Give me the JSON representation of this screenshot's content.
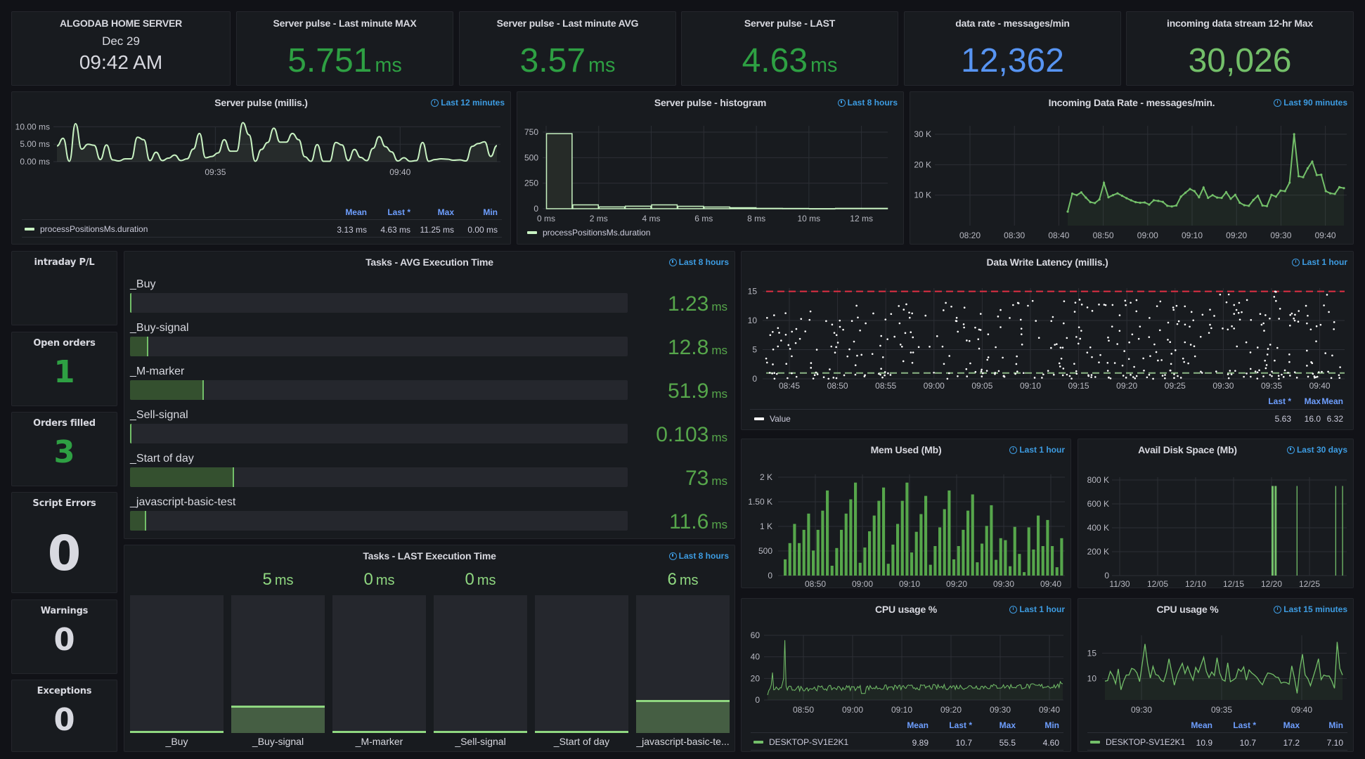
{
  "colors": {
    "green": "#2ea043",
    "green_light": "#73bf69",
    "line_pale": "#c8f2c2",
    "blue": "#5794f2",
    "threshold_red": "#e02f44",
    "threshold_green": "#8ab383"
  },
  "header_panel": {
    "title": "ALGODAB HOME SERVER",
    "date": "Dec 29",
    "time": "09:42 AM"
  },
  "stats": [
    {
      "title": "Server pulse - Last minute MAX",
      "value": "5.751",
      "unit": "ms",
      "color": "#2ea043"
    },
    {
      "title": "Server pulse - Last minute AVG",
      "value": "3.57",
      "unit": "ms",
      "color": "#2ea043"
    },
    {
      "title": "Server pulse - LAST",
      "value": "4.63",
      "unit": "ms",
      "color": "#2ea043"
    },
    {
      "title": "data rate - messages/min",
      "value": "12,362",
      "unit": "",
      "color": "#5794f2"
    },
    {
      "title": "incoming data stream 12-hr Max",
      "value": "30,026",
      "unit": "",
      "color": "#73bf69"
    }
  ],
  "side_stats": [
    {
      "title": "intraday P/L",
      "value": "",
      "color": "#2ea043"
    },
    {
      "title": "Open orders",
      "value": "1",
      "color": "#2ea043"
    },
    {
      "title": "Orders filled",
      "value": "3",
      "color": "#2ea043"
    },
    {
      "title": "Script Errors",
      "value": "0",
      "color": "#d8d9e0"
    },
    {
      "title": "Warnings",
      "value": "0",
      "color": "#d8d9e0"
    },
    {
      "title": "Exceptions",
      "value": "0",
      "color": "#d8d9e0"
    }
  ],
  "chart_data": [
    {
      "id": "server_pulse",
      "type": "line",
      "title": "Server pulse (millis.)",
      "time_range": "Last 12 minutes",
      "yticks": [
        "0.00 ms",
        "5.00 ms",
        "10.00 ms"
      ],
      "ylim": [
        0,
        11.5
      ],
      "xticks": [
        {
          "label": "09:35",
          "pos": 0.36
        },
        {
          "label": "09:40",
          "pos": 0.78
        }
      ],
      "series": [
        {
          "name": "processPositionsMs.duration",
          "values": [
            4.5,
            6.7,
            0.1,
            10.9,
            3.6,
            5.0,
            4.7,
            0.6,
            4.8,
            0.5,
            0.2,
            0.8,
            0.8,
            7.0,
            6.3,
            0.3,
            2.7,
            0.3,
            1.0,
            1.9,
            0.3,
            0.8,
            3.6,
            8.1,
            1.1,
            1.5,
            2.5,
            6.3,
            3.0,
            3.0,
            11.2,
            7.7,
            0.1,
            3.5,
            5.5,
            9.6,
            5.6,
            5.6,
            8.1,
            6.3,
            1.4,
            0.1,
            4.9,
            0.1,
            0.1,
            5.5,
            4.8,
            0.3,
            3.5,
            1.2,
            0.3,
            3.8,
            7.2,
            4.3,
            2.8,
            0.2,
            1.1,
            0.1,
            0.3,
            5.5,
            0.1,
            0.6,
            0.8,
            0.7,
            0.4,
            0.5,
            0.2,
            4.4,
            5.2,
            5.7,
            1.5,
            4.6
          ]
        }
      ],
      "legend_headers": [
        "Mean",
        "Last *",
        "Max",
        "Min"
      ],
      "legend_values": [
        "3.13 ms",
        "4.63 ms",
        "11.25 ms",
        "0.00 ms"
      ]
    },
    {
      "id": "histogram",
      "type": "bar",
      "title": "Server pulse - histogram",
      "time_range": "Last 8 hours",
      "yticks": [
        "0",
        "250",
        "500",
        "750"
      ],
      "ylim": [
        0,
        800
      ],
      "xticks": [
        "0 ms",
        "2 ms",
        "4 ms",
        "6 ms",
        "8 ms",
        "10 ms",
        "12 ms"
      ],
      "xlim": [
        0,
        13
      ],
      "bins": [
        735,
        38,
        18,
        25,
        38,
        24,
        17,
        10,
        4,
        3,
        1,
        4,
        4
      ],
      "series_name": "processPositionsMs.duration"
    },
    {
      "id": "data_rate",
      "type": "line",
      "title": "Incoming Data Rate - messages/min.",
      "time_range": "Last 90 minutes",
      "yticks": [
        "10 K",
        "20 K",
        "30 K"
      ],
      "ylim": [
        0,
        33000
      ],
      "xticks": [
        "08:20",
        "08:30",
        "08:40",
        "08:50",
        "09:00",
        "09:10",
        "09:20",
        "09:30",
        "09:40"
      ],
      "x_start_min": 8.0,
      "x_end_min": 100,
      "start_offset_min": 32,
      "values": [
        4600,
        10500,
        10000,
        10900,
        9200,
        7700,
        7400,
        8600,
        14000,
        9300,
        10000,
        10600,
        9800,
        9000,
        8300,
        7700,
        7500,
        7600,
        6900,
        8300,
        8100,
        7800,
        6500,
        6300,
        6600,
        9500,
        10800,
        12000,
        11300,
        9300,
        12500,
        9100,
        10000,
        9200,
        9100,
        11000,
        8800,
        10100,
        7500,
        6700,
        6500,
        8400,
        9800,
        6600,
        6400,
        10100,
        9500,
        11500,
        11300,
        14100,
        30000,
        16200,
        15900,
        18800,
        21000,
        16600,
        16700,
        11300,
        10600,
        10400,
        12600,
        12300
      ]
    },
    {
      "id": "write_latency",
      "type": "scatter",
      "title": "Data Write Latency (millis.)",
      "time_range": "Last 1 hour",
      "yticks": [
        "0",
        "5",
        "10",
        "15"
      ],
      "ylim": [
        0,
        17
      ],
      "xticks": [
        "08:45",
        "08:50",
        "08:55",
        "09:00",
        "09:05",
        "09:10",
        "09:15",
        "09:20",
        "09:25",
        "09:30",
        "09:35",
        "09:40"
      ],
      "thresholds": [
        15,
        1
      ],
      "point_count": 420,
      "legend_name": "Value",
      "legend_headers": [
        "Last *",
        "Max",
        "Mean"
      ],
      "legend_values": [
        "5.63",
        "16.0",
        "6.32"
      ]
    },
    {
      "id": "mem_used",
      "type": "bar",
      "title": "Mem Used (Mb)",
      "time_range": "Last 1 hour",
      "yticks": [
        "0",
        "500",
        "1 K",
        "1.50 K",
        "2 K"
      ],
      "ylim": [
        0,
        2100
      ],
      "xticks": [
        "08:50",
        "09:00",
        "09:10",
        "09:20",
        "09:30",
        "09:40"
      ],
      "values": [
        330,
        660,
        1050,
        660,
        930,
        1260,
        510,
        930,
        1320,
        1730,
        200,
        560,
        930,
        1260,
        1550,
        1890,
        260,
        570,
        900,
        1220,
        1520,
        1790,
        240,
        630,
        1050,
        1520,
        1890,
        470,
        890,
        1250,
        1620,
        220,
        600,
        980,
        1350,
        1730,
        330,
        600,
        930,
        1320,
        1650,
        270,
        650,
        1010,
        1430,
        320,
        760,
        720,
        190,
        990,
        440,
        70,
        980,
        530,
        1220,
        600,
        1130,
        600,
        170,
        760
      ]
    },
    {
      "id": "disk_space",
      "type": "bar",
      "title": "Avail Disk Space (Mb)",
      "time_range": "Last 30 days",
      "yticks": [
        "0",
        "200 K",
        "400 K",
        "600 K",
        "800 K"
      ],
      "ylim": [
        0,
        820000
      ],
      "xticks": [
        "11/30",
        "12/05",
        "12/10",
        "12/15",
        "12/20",
        "12/25"
      ],
      "spikes": [
        {
          "day": 20.0,
          "value": 750000
        },
        {
          "day": 20.4,
          "value": 750000
        },
        {
          "day": 23.3,
          "value": 750000
        },
        {
          "day": 28.4,
          "value": 750000
        },
        {
          "day": 29.3,
          "value": 750000
        }
      ]
    },
    {
      "id": "cpu_1h",
      "type": "line",
      "title": "CPU usage %",
      "time_range": "Last 1 hour",
      "yticks": [
        "0",
        "20",
        "40",
        "60"
      ],
      "ylim": [
        0,
        62
      ],
      "xticks": [
        "08:50",
        "09:00",
        "09:10",
        "09:20",
        "09:30",
        "09:40"
      ],
      "series_name": "DESKTOP-SV1E2K1",
      "legend_headers": [
        "Mean",
        "Last *",
        "Max",
        "Min"
      ],
      "legend_values": [
        "9.89",
        "10.7",
        "55.5",
        "4.60"
      ]
    },
    {
      "id": "cpu_15m",
      "type": "line",
      "title": "CPU usage %",
      "time_range": "Last 15 minutes",
      "yticks": [
        "10",
        "15"
      ],
      "ylim": [
        5.8,
        18.5
      ],
      "xticks": [
        "09:30",
        "09:35",
        "09:40"
      ],
      "values": [
        9.5,
        9.6,
        11.4,
        10.5,
        9.0,
        11.9,
        7.8,
        9.5,
        10.7,
        10.7,
        12.0,
        11.8,
        11.1,
        9.4,
        13.0,
        16.8,
        12.8,
        10.1,
        12.4,
        10.8,
        10.6,
        9.7,
        9.4,
        11.1,
        13.9,
        11.3,
        8.7,
        10.7,
        11.9,
        13.0,
        11.0,
        12.4,
        10.9,
        9.7,
        12.2,
        11.2,
        12.7,
        14.2,
        11.4,
        10.2,
        11.3,
        10.6,
        14.1,
        11.1,
        9.8,
        9.5,
        13.1,
        9.4,
        9.7,
        10.1,
        11.9,
        11.4,
        12.3,
        9.7,
        11.7,
        11.1,
        10.7,
        10.2,
        9.4,
        8.8,
        10.1,
        11.1,
        11.0,
        10.8,
        10.3,
        10.2,
        9.1,
        9.3,
        9.2,
        8.9,
        12.5,
        10.1,
        7.1,
        11.8,
        14.8,
        10.7,
        10.0,
        8.6,
        10.3,
        12.0,
        13.9,
        9.8,
        10.7,
        10.5,
        10.5,
        9.5,
        8.1,
        17.2,
        12.0,
        10.7
      ],
      "series_name": "DESKTOP-SV1E2K1",
      "legend_headers": [
        "Mean",
        "Last *",
        "Max",
        "Min"
      ],
      "legend_values": [
        "10.9",
        "10.7",
        "17.2",
        "7.10"
      ]
    },
    {
      "id": "tasks_avg",
      "type": "bar",
      "title": "Tasks - AVG Execution Time",
      "time_range": "Last 8 hours",
      "max": 350,
      "categories": [
        "_Buy",
        "_Buy-signal",
        "_M-marker",
        "_Sell-signal",
        "_Start of day",
        "_javascript-basic-test"
      ],
      "values": [
        1.23,
        12.8,
        51.9,
        0.103,
        73,
        11.6
      ],
      "labels": [
        "1.23",
        "12.8",
        "51.9",
        "0.103",
        "73",
        "11.6"
      ],
      "unit": "ms"
    },
    {
      "id": "tasks_last",
      "type": "bar",
      "title": "Tasks - LAST Execution Time",
      "time_range": "Last 8 hours",
      "max": 25,
      "categories": [
        "_Buy",
        "_Buy-signal",
        "_M-marker",
        "_Sell-signal",
        "_Start of day",
        "_javascript-basic-te..."
      ],
      "values": [
        0,
        5,
        0,
        0,
        0,
        6
      ],
      "labels": [
        "",
        "5",
        "0",
        "0",
        "",
        "6"
      ],
      "unit": "ms"
    }
  ]
}
